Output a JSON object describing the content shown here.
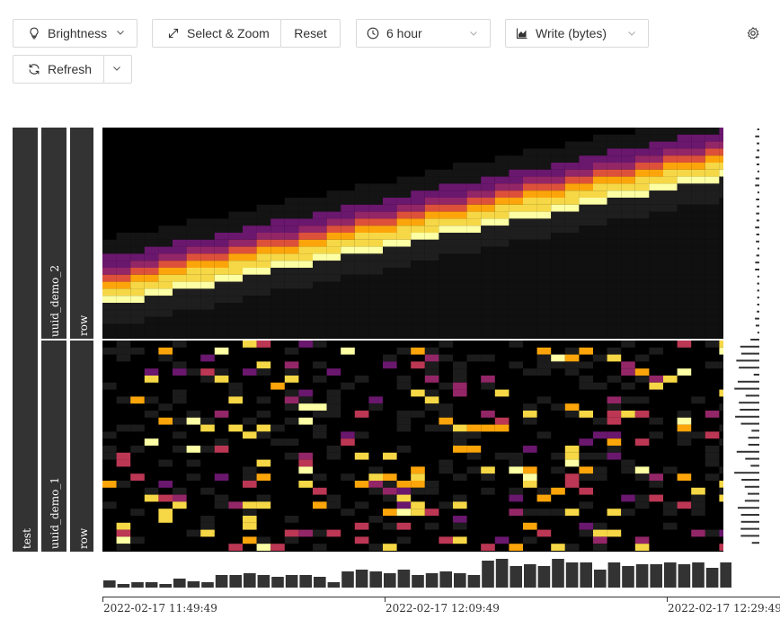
{
  "toolbar": {
    "brightness": {
      "label": "Brightness",
      "icon": "bulb-icon"
    },
    "select_zoom": {
      "label": "Select & Zoom",
      "icon": "expand-arrows-icon"
    },
    "reset": {
      "label": "Reset"
    },
    "time_range": {
      "label": "6 hour",
      "icon": "clock-icon"
    },
    "metric": {
      "label": "Write (bytes)",
      "icon": "area-chart-icon"
    },
    "settings": {
      "icon": "gear-icon"
    },
    "refresh": {
      "label": "Refresh",
      "icon": "refresh-icon"
    }
  },
  "labels": {
    "level0": [
      "test"
    ],
    "level1": [
      "uuid_demo_2",
      "uuid_demo_1"
    ],
    "level2": [
      "row",
      "row"
    ]
  },
  "timeline": {
    "ticks": [
      "2022-02-17 11:49:49",
      "2022-02-17 12:09:49",
      "2022-02-17 12:29:49"
    ]
  },
  "colors": {
    "heatmap_scale": [
      "#000000",
      "#1a1a1a",
      "#2a2a2a",
      "#3d1259",
      "#6a176e",
      "#932667",
      "#bc3754",
      "#dd513a",
      "#f37819",
      "#fca50a",
      "#f6d746",
      "#fcffa4"
    ],
    "bars": "#333333"
  },
  "chart_data": {
    "type": "heatmap",
    "x_range": [
      "2022-02-17 11:49:49",
      "2022-02-17 12:29:49"
    ],
    "summary_bars": [
      8,
      4,
      6,
      6,
      4,
      10,
      7,
      6,
      14,
      14,
      16,
      14,
      12,
      14,
      14,
      12,
      6,
      18,
      20,
      18,
      16,
      20,
      14,
      16,
      18,
      16,
      14,
      30,
      32,
      24,
      26,
      24,
      32,
      28,
      28,
      20,
      28,
      24,
      26,
      26,
      28,
      26,
      28,
      22,
      28,
      30,
      34,
      22,
      16
    ]
  }
}
